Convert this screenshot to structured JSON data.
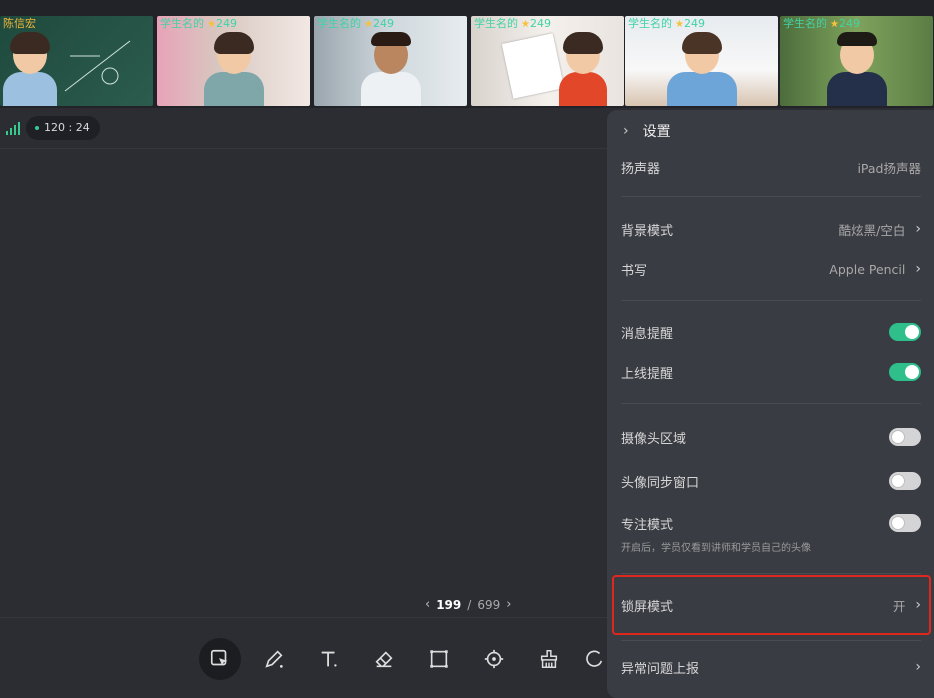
{
  "video_strip": {
    "tiles": [
      {
        "name": "陈信宏",
        "score": "",
        "star": false,
        "role": "teacher"
      },
      {
        "name": "学生名的",
        "score": "249",
        "star": true,
        "role": "student"
      },
      {
        "name": "学生名的",
        "score": "249",
        "star": true,
        "role": "student"
      },
      {
        "name": "学生名的",
        "score": "249",
        "star": true,
        "role": "student"
      },
      {
        "name": "学生名的",
        "score": "249",
        "star": true,
        "role": "student"
      },
      {
        "name": "学生名的",
        "score": "249",
        "star": true,
        "role": "student"
      }
    ]
  },
  "status": {
    "timer": "120 : 24"
  },
  "pager": {
    "current": "199",
    "separator": "/",
    "total": "699"
  },
  "toolbar": {
    "tools": [
      "select-icon",
      "pen-icon",
      "text-icon",
      "eraser-icon",
      "rectangle-icon",
      "laser-pointer-icon",
      "clear-icon",
      "undo-icon"
    ]
  },
  "settings": {
    "title": "设置",
    "speaker_label": "扬声器",
    "speaker_value": "iPad扬声器",
    "background_label": "背景模式",
    "background_value": "酷炫黑/空白",
    "writing_label": "书写",
    "writing_value": "Apple Pencil",
    "message_alert_label": "消息提醒",
    "message_alert_on": true,
    "online_alert_label": "上线提醒",
    "online_alert_on": true,
    "camera_area_label": "摄像头区域",
    "camera_area_on": false,
    "avatar_sync_label": "头像同步窗口",
    "avatar_sync_on": false,
    "focus_mode_label": "专注模式",
    "focus_mode_on": false,
    "focus_mode_hint": "开启后，学员仅看到讲师和学员自己的头像",
    "lock_screen_label": "锁屏模式",
    "lock_screen_value": "开",
    "report_label": "异常问题上报"
  },
  "colors": {
    "accent": "#2fbf8a",
    "highlight": "#e0271d",
    "panel": "#3a3c43",
    "background": "#2b2d33"
  }
}
